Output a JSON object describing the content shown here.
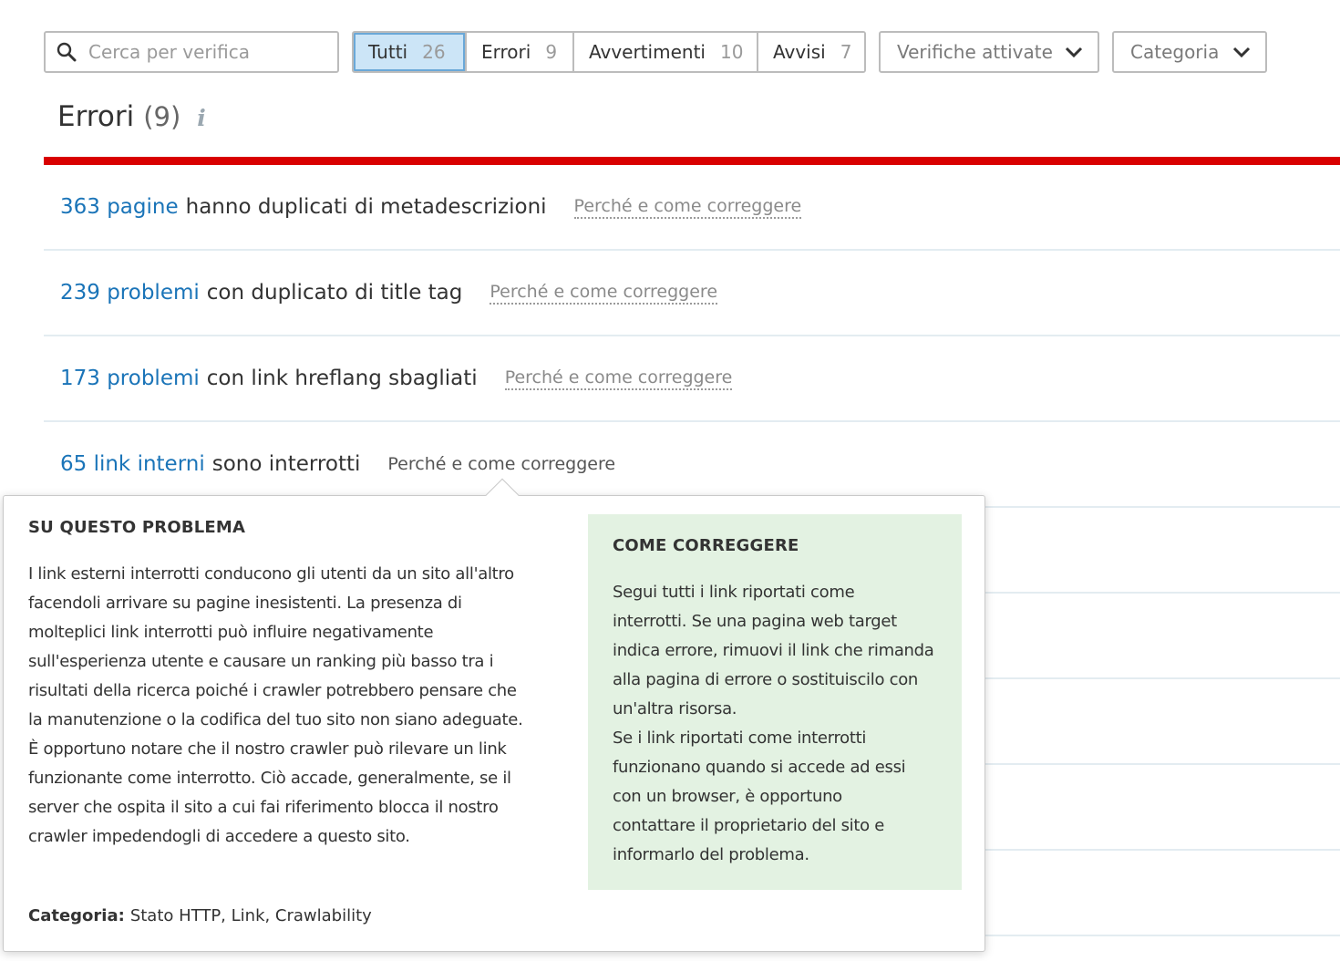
{
  "search": {
    "placeholder": "Cerca per verifica"
  },
  "filters": [
    {
      "label": "Tutti",
      "count": "26",
      "active": true
    },
    {
      "label": "Errori",
      "count": "9"
    },
    {
      "label": "Avvertimenti",
      "count": "10"
    },
    {
      "label": "Avvisi",
      "count": "7"
    }
  ],
  "dropdowns": {
    "checks": "Verifiche attivate",
    "category": "Categoria"
  },
  "section": {
    "title": "Errori",
    "count": "(9)",
    "info_icon": "i",
    "accent_color": "#d90000"
  },
  "issues": [
    {
      "count": "363 pagine",
      "text": "hanno duplicati di metadescrizioni",
      "link": "Perché e come correggere"
    },
    {
      "count": "239 problemi",
      "text": "con duplicato di title tag",
      "link": "Perché e come correggere"
    },
    {
      "count": "173 problemi",
      "text": "con link hreflang sbagliati",
      "link": "Perché e come correggere"
    },
    {
      "count": "65 link interni",
      "text": "sono interrotti",
      "link": "Perché e come correggere"
    }
  ],
  "popover": {
    "about_title": "SU QUESTO PROBLEMA",
    "about_lines": [
      "I link esterni interrotti conducono gli utenti da un sito all'altro",
      "facendoli arrivare su pagine inesistenti. La presenza di",
      "molteplici link interrotti può influire negativamente",
      "sull'esperienza utente e causare un ranking più basso tra i",
      "risultati della ricerca poiché i crawler potrebbero pensare che",
      "la manutenzione o la codifica del tuo sito non siano adeguate.",
      "È opportuno notare che il nostro crawler può rilevare un link",
      "funzionante come interrotto. Ciò accade, generalmente, se il",
      "server che ospita il sito a cui fai riferimento blocca il nostro",
      "crawler impedendogli di accedere a questo sito."
    ],
    "fix_title": "COME CORREGGERE",
    "fix_lines": [
      "Segui tutti i link riportati come",
      "interrotti. Se una pagina web target",
      "indica errore, rimuovi il link che rimanda",
      "alla pagina di errore o sostituiscilo con",
      "un'altra risorsa.",
      "Se i link riportati come interrotti",
      "funzionano quando si accede ad essi",
      "con un browser, è opportuno",
      "contattare il proprietario del sito e",
      "informarlo del problema."
    ],
    "category_label": "Categoria:",
    "category_value": "Stato HTTP, Link, Crawlability"
  }
}
